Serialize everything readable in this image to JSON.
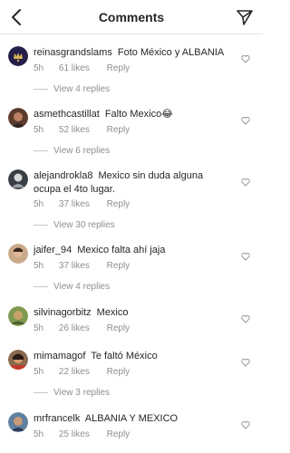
{
  "header": {
    "title": "Comments"
  },
  "comments": [
    {
      "username": "reinasgrandslams",
      "text": "Foto México y ALBANIA",
      "time": "5h",
      "likes": "61 likes",
      "reply": "Reply",
      "view_replies": "View 4 replies"
    },
    {
      "username": "asmethcastillat",
      "text": "Falto Mexico😂",
      "time": "5h",
      "likes": "52 likes",
      "reply": "Reply",
      "view_replies": "View 6 replies"
    },
    {
      "username": "alejandrokla8",
      "text": "Mexico sin duda alguna ocupa el 4to lugar.",
      "time": "5h",
      "likes": "37 likes",
      "reply": "Reply",
      "view_replies": "View 30 replies"
    },
    {
      "username": "jaifer_94",
      "text": "Mexico falta ahí jaja",
      "time": "5h",
      "likes": "37 likes",
      "reply": "Reply",
      "view_replies": "View 4 replies"
    },
    {
      "username": "silvinagorbitz",
      "text": "Mexico",
      "time": "5h",
      "likes": "26 likes",
      "reply": "Reply",
      "view_replies": ""
    },
    {
      "username": "mimamagof",
      "text": "Te faltó México",
      "time": "5h",
      "likes": "22 likes",
      "reply": "Reply",
      "view_replies": "View 3 replies"
    },
    {
      "username": "mrfrancelk",
      "text": "ALBANIA Y MEXICO",
      "time": "5h",
      "likes": "25 likes",
      "reply": "Reply",
      "view_replies": ""
    }
  ],
  "icons": {
    "back": "chevron-left-icon",
    "send": "paper-plane-icon",
    "like": "heart-outline-icon"
  },
  "colors": {
    "text": "#262626",
    "secondary": "#8e8e8e",
    "divider": "#e3e3e3"
  }
}
